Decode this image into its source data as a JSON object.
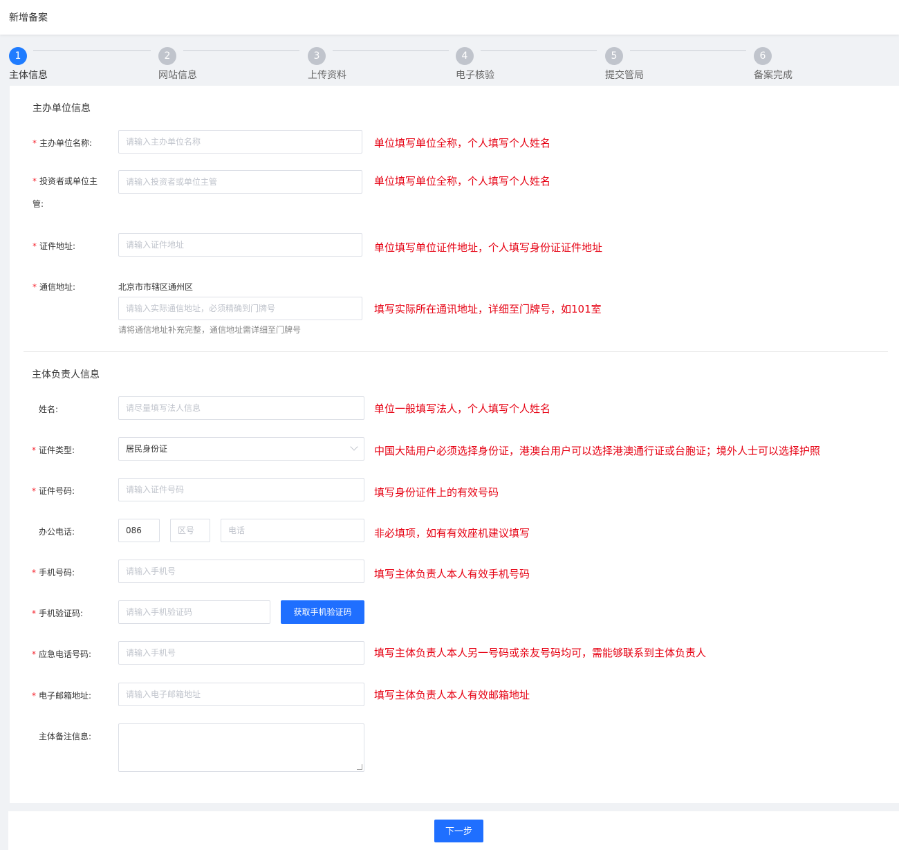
{
  "header": {
    "title": "新增备案"
  },
  "steps": [
    {
      "num": "1",
      "label": "主体信息"
    },
    {
      "num": "2",
      "label": "网站信息"
    },
    {
      "num": "3",
      "label": "上传资料"
    },
    {
      "num": "4",
      "label": "电子核验"
    },
    {
      "num": "5",
      "label": "提交管局"
    },
    {
      "num": "6",
      "label": "备案完成"
    }
  ],
  "org_section": {
    "title": "主办单位信息",
    "org_name": {
      "label": "主办单位名称:",
      "placeholder": "请输入主办单位名称",
      "hint": "单位填写单位全称，个人填写个人姓名"
    },
    "investor": {
      "label": "投资者或单位主管:",
      "placeholder": "请输入投资者或单位主管",
      "hint": "单位填写单位全称，个人填写个人姓名"
    },
    "cert_address": {
      "label": "证件地址:",
      "placeholder": "请输入证件地址",
      "hint": "单位填写单位证件地址，个人填写身份证证件地址"
    },
    "mail_address": {
      "label": "通信地址:",
      "region": "北京市市辖区通州区",
      "placeholder": "请输入实际通信地址，必须精确到门牌号",
      "help": "请将通信地址补充完整，通信地址需详细至门牌号",
      "hint": "填写实际所在通讯地址，详细至门牌号，如101室"
    }
  },
  "person_section": {
    "title": "主体负责人信息",
    "name": {
      "label": "姓名:",
      "placeholder": "请尽量填写法人信息",
      "hint": "单位一般填写法人，个人填写个人姓名"
    },
    "id_type": {
      "label": "证件类型:",
      "value": "居民身份证",
      "hint": "中国大陆用户必须选择身份证，港澳台用户可以选择港澳通行证或台胞证；境外人士可以选择护照"
    },
    "id_number": {
      "label": "证件号码:",
      "placeholder": "请输入证件号码",
      "hint": "填写身份证件上的有效号码"
    },
    "office_phone": {
      "label": "办公电话:",
      "country_code": "086",
      "area_placeholder": "区号",
      "phone_placeholder": "电话",
      "hint": "非必填项，如有有效座机建议填写"
    },
    "mobile": {
      "label": "手机号码:",
      "placeholder": "请输入手机号",
      "hint": "填写主体负责人本人有效手机号码"
    },
    "sms_code": {
      "label": "手机验证码:",
      "placeholder": "请输入手机验证码",
      "button": "获取手机验证码"
    },
    "emergency": {
      "label": "应急电话号码:",
      "placeholder": "请输入手机号",
      "hint": "填写主体负责人本人另一号码或亲友号码均可，需能够联系到主体负责人"
    },
    "email": {
      "label": "电子邮箱地址:",
      "placeholder": "请输入电子邮箱地址",
      "hint": "填写主体负责人本人有效邮箱地址"
    },
    "remarks": {
      "label": "主体备注信息:"
    }
  },
  "footer": {
    "next_label": "下一步"
  },
  "colors": {
    "primary": "#1f6fff",
    "required": "#f5222d",
    "hint": "#e60012"
  }
}
